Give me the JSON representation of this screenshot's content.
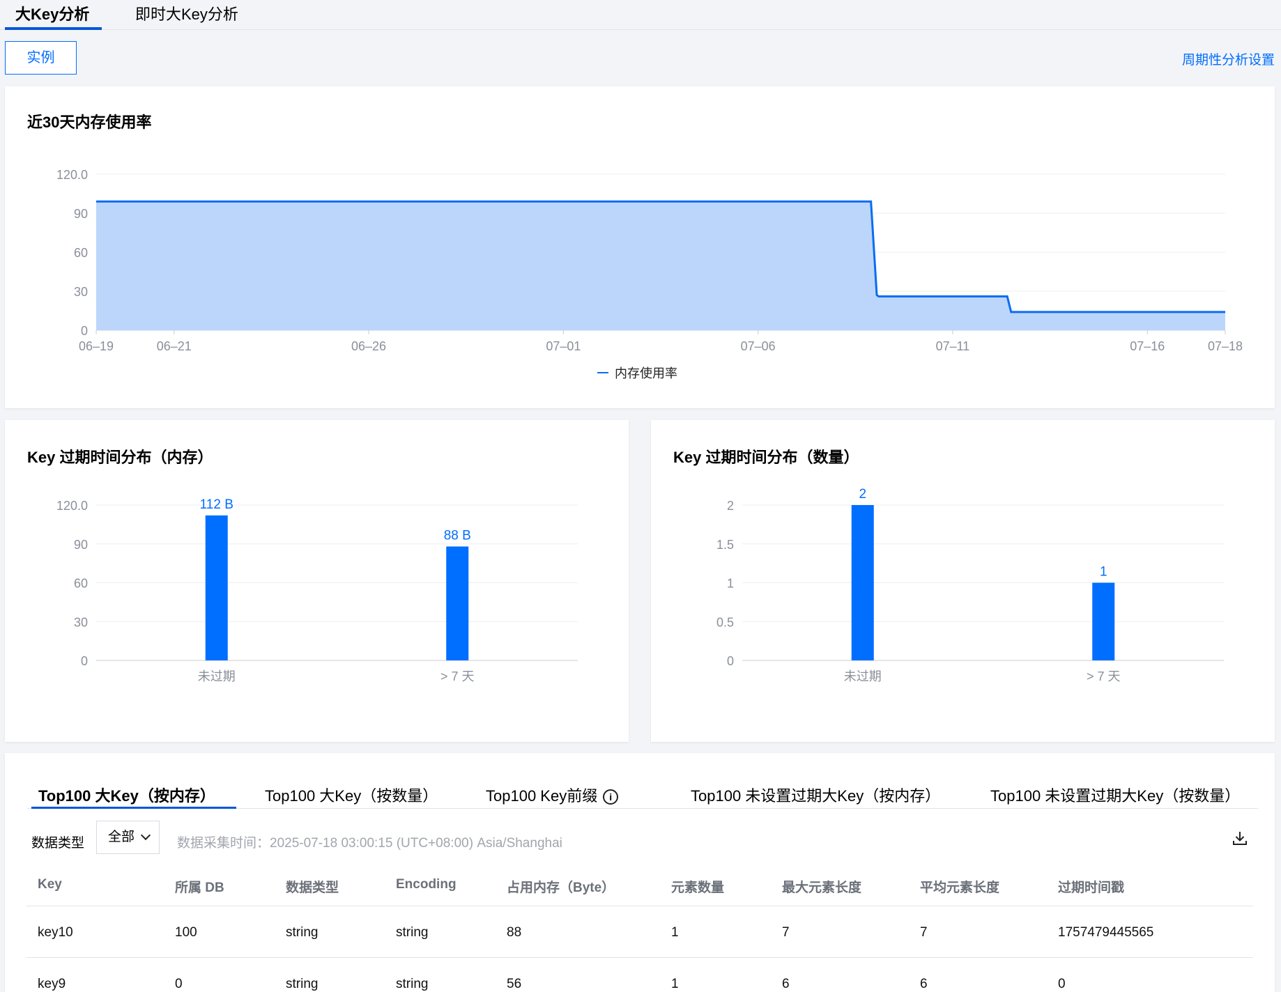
{
  "top_tabs": [
    "大Key分析",
    "即时大Key分析"
  ],
  "instance_button": "实例",
  "periodic_settings": "周期性分析设置",
  "memory_chart": {
    "title": "近30天内存使用率",
    "legend": "内存使用率",
    "chart_data": {
      "type": "area",
      "x_ticks": [
        "06–19",
        "06–21",
        "06–26",
        "07–01",
        "07–06",
        "07–11",
        "07–16",
        "07–18"
      ],
      "y_ticks": [
        "0",
        "30",
        "60",
        "90",
        "120.0"
      ],
      "ylim": [
        0,
        120
      ],
      "xlim_days": [
        0,
        29
      ],
      "series": [
        {
          "name": "内存使用率",
          "points": [
            [
              0,
              99
            ],
            [
              19.9,
              99
            ],
            [
              20.05,
              27
            ],
            [
              20.1,
              26
            ],
            [
              23.4,
              26
            ],
            [
              23.5,
              14
            ],
            [
              29,
              14
            ]
          ]
        }
      ],
      "color": "#0a6cf2",
      "fill": "#bcd6fb"
    }
  },
  "expire_mem_chart": {
    "title": "Key 过期时间分布（内存）",
    "chart_data": {
      "type": "bar",
      "categories": [
        "未过期",
        "> 7 天"
      ],
      "values": [
        112,
        88
      ],
      "labels": [
        "112 B",
        "88 B"
      ],
      "y_ticks": [
        "0",
        "30",
        "60",
        "90",
        "120.0"
      ],
      "ylim": [
        0,
        120
      ],
      "color": "#006eff"
    }
  },
  "expire_count_chart": {
    "title": "Key 过期时间分布（数量）",
    "chart_data": {
      "type": "bar",
      "categories": [
        "未过期",
        "> 7 天"
      ],
      "values": [
        2,
        1
      ],
      "labels": [
        "2",
        "1"
      ],
      "y_ticks": [
        "0",
        "0.5",
        "1",
        "1.5",
        "2"
      ],
      "ylim": [
        0,
        2
      ],
      "color": "#006eff"
    }
  },
  "bottom_tabs": [
    "Top100 大Key（按内存）",
    "Top100 大Key（按数量）",
    "Top100 Key前缀",
    "Top100 未设置过期大Key（按内存）",
    "Top100 未设置过期大Key（按数量）"
  ],
  "filter": {
    "label": "数据类型",
    "selected": "全部",
    "collect_time": "数据采集时间：2025-07-18 03:00:15 (UTC+08:00) Asia/Shanghai"
  },
  "table": {
    "columns": [
      "Key",
      "所属 DB",
      "数据类型",
      "Encoding",
      "占用内存（Byte）",
      "元素数量",
      "最大元素长度",
      "平均元素长度",
      "过期时间戳"
    ],
    "rows": [
      [
        "key10",
        "100",
        "string",
        "string",
        "88",
        "1",
        "7",
        "7",
        "1757479445565"
      ],
      [
        "key9",
        "0",
        "string",
        "string",
        "56",
        "1",
        "6",
        "6",
        "0"
      ]
    ]
  },
  "icons": {
    "info": "info-icon",
    "download": "download-icon",
    "dropdown": "chevron-down-icon"
  }
}
